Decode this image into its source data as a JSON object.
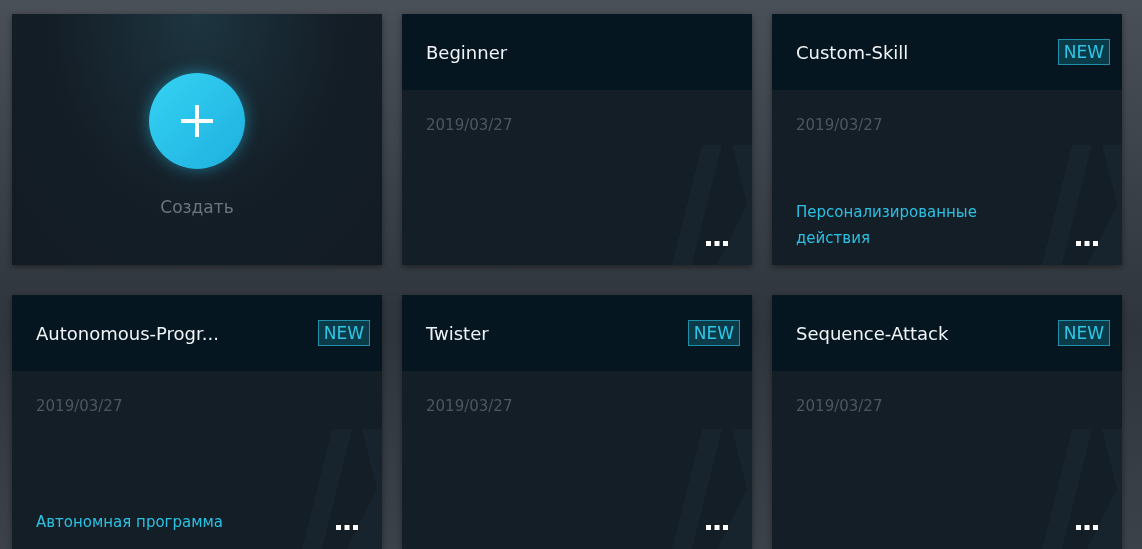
{
  "cards": [
    {
      "kind": "create",
      "label": "Создать"
    },
    {
      "kind": "project",
      "title": "Beginner",
      "date": "2019/03/27"
    },
    {
      "kind": "project",
      "title": "Custom-Skill",
      "badge": "NEW",
      "date": "2019/03/27",
      "subtitle": "Персонализированные действия"
    },
    {
      "kind": "project",
      "title": "Autonomous-Progr...",
      "badge": "NEW",
      "date": "2019/03/27",
      "subtitle": "Автономная программа"
    },
    {
      "kind": "project",
      "title": "Twister",
      "badge": "NEW",
      "date": "2019/03/27"
    },
    {
      "kind": "project",
      "title": "Sequence-Attack",
      "badge": "NEW",
      "date": "2019/03/27"
    }
  ]
}
